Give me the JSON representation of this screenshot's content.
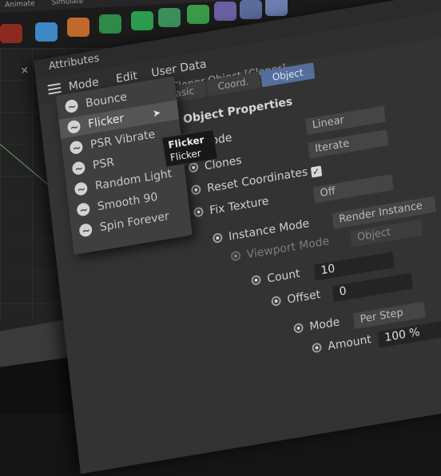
{
  "menubar": [
    "Animate",
    "Simulate"
  ],
  "panel": {
    "close": "×",
    "title": "Attributes",
    "menu": [
      "Mode",
      "Edit",
      "User Data"
    ],
    "object_title": "Cloner Object [Cloner]",
    "tabs": [
      "Basic",
      "Coord.",
      "Object"
    ],
    "active_tab": "Object",
    "section_title": "Object Properties",
    "mode_label": "Mode",
    "mode_value": "Linear",
    "clones_label": "Clones",
    "clones_value": "Iterate",
    "reset_label": "Reset Coordinates",
    "fix_label": "Fix Texture",
    "fix_value": "Off",
    "instance_label": "Instance Mode",
    "instance_value": "Render Instance",
    "viewport_label": "Viewport Mode",
    "viewport_value": "Object",
    "count_label": "Count",
    "count_value": "10",
    "offset_label": "Offset",
    "offset_value": "0",
    "mode2_label": "Mode",
    "mode2_value": "Per Step",
    "amount_label": "Amount",
    "amount_value": "100 %"
  },
  "preset_menu": {
    "items": [
      "Bounce",
      "Flicker",
      "PSR Vibrate",
      "PSR",
      "Random Light",
      "Smooth 90",
      "Spin Forever"
    ],
    "highlighted": "Flicker"
  },
  "tooltip": {
    "title": "Flicker",
    "text": "Flicker"
  }
}
